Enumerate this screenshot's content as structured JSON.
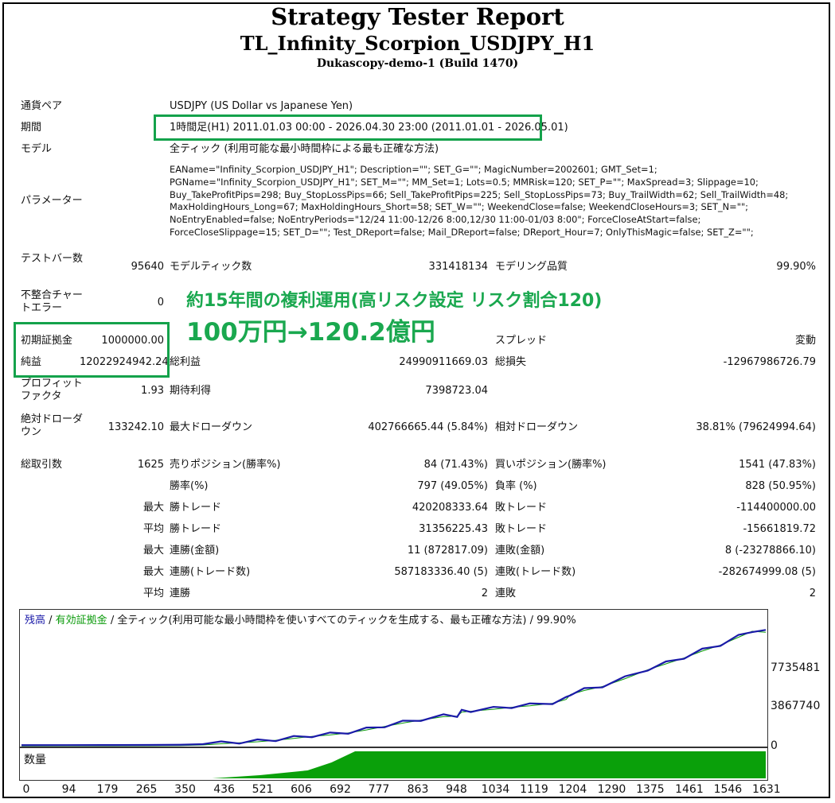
{
  "header": {
    "title": "Strategy Tester Report",
    "ea_name": "TL_Infinity_Scorpion_USDJPY_H1",
    "server": "Dukascopy-demo-1 (Build 1470)"
  },
  "info": {
    "pair_label": "通貨ペア",
    "pair_value": "USDJPY (US Dollar vs Japanese Yen)",
    "period_label": "期間",
    "period_value": "1時間足(H1) 2011.01.03 00:00 - 2026.04.30 23:00 (2011.01.01 - 2026.05.01)",
    "model_label": "モデル",
    "model_value": "全ティック (利用可能な最小時間枠による最も正確な方法)",
    "params_label": "パラメーター",
    "params_value": "EAName=\"Infinity_Scorpion_USDJPY_H1\"; Description=\"\"; SET_G=\"\"; MagicNumber=2002601; GMT_Set=1;\nPGName=\"Infinity_Scorpion_USDJPY_H1\"; SET_M=\"\"; MM_Set=1; Lots=0.5; MMRisk=120; SET_P=\"\"; MaxSpread=3; Slippage=10;\nBuy_TakeProfitPips=298; Buy_StopLossPips=66; Sell_TakeProfitPips=225; Sell_StopLossPips=73; Buy_TrailWidth=62; Sell_TrailWidth=48;\nMaxHoldingHours_Long=67; MaxHoldingHours_Short=58; SET_W=\"\"; WeekendClose=false; WeekendCloseHours=3; SET_N=\"\";\nNoEntryEnabled=false; NoEntryPeriods=\"12/24 11:00-12/26 8:00,12/30 11:00-01/03 8:00\"; ForceCloseAtStart=false;\nForceCloseSlippage=15; SET_D=\"\"; Test_DReport=false; Mail_DReport=false; DReport_Hour=7; OnlyThisMagic=false; SET_Z=\"\";"
  },
  "stats": {
    "bars_label": "テストバー数",
    "bars_value": "95640",
    "ticks_label": "モデルティック数",
    "ticks_value": "331418134",
    "quality_label": "モデリング品質",
    "quality_value": "99.90%",
    "mismatch_label": "不整合チャートエラー",
    "mismatch_value": "0",
    "deposit_label": "初期証拠金",
    "deposit_value": "1000000.00",
    "spread_label": "スプレッド",
    "spread_value": "変動",
    "net_label": "純益",
    "net_value": "12022924942.24",
    "gross_profit_label": "総利益",
    "gross_profit_value": "24990911669.03",
    "gross_loss_label": "総損失",
    "gross_loss_value": "-12967986726.79",
    "pf_label": "プロフィットファクタ",
    "pf_value": "1.93",
    "expected_label": "期待利得",
    "expected_value": "7398723.04",
    "abs_dd_label": "絶対ドローダウン",
    "abs_dd_value": "133242.10",
    "max_dd_label": "最大ドローダウン",
    "max_dd_value": "402766665.44 (5.84%)",
    "rel_dd_label": "相対ドローダウン",
    "rel_dd_value": "38.81% (79624994.64)",
    "trades_label": "総取引数",
    "trades_value": "1625",
    "short_label": "売りポジション(勝率%)",
    "short_value": "84 (71.43%)",
    "long_label": "買いポジション(勝率%)",
    "long_value": "1541 (47.83%)",
    "winrate_label": "勝率(%)",
    "winrate_value": "797 (49.05%)",
    "lossrate_label": "負率 (%)",
    "lossrate_value": "828 (50.95%)",
    "max_label": "最大",
    "avg_label": "平均",
    "largest_win_label": "勝トレード",
    "largest_win_value": "420208333.64",
    "largest_loss_label": "敗トレード",
    "largest_loss_value": "-114400000.00",
    "avg_win_label": "勝トレード",
    "avg_win_value": "31356225.43",
    "avg_loss_label": "敗トレード",
    "avg_loss_value": "-15661819.72",
    "max_consec_win_label": "連勝(金額)",
    "max_consec_win_value": "11 (872817.09)",
    "max_consec_loss_label": "連敗(金額)",
    "max_consec_loss_value": "8 (-23278866.10)",
    "max_consec_profit_label": "連勝(トレード数)",
    "max_consec_profit_value": "587183336.40 (5)",
    "max_consec_lossamt_label": "連敗(トレード数)",
    "max_consec_lossamt_value": "-282674999.08 (5)",
    "avg_consec_win_label": "連勝",
    "avg_consec_win_value": "2",
    "avg_consec_loss_label": "連敗",
    "avg_consec_loss_value": "2"
  },
  "annotation": {
    "line1": "約15年間の複利運用(高リスク設定 リスク割合120)",
    "line2": "100万円→120.2億円",
    "color": "#1aa84f"
  },
  "chart_data": {
    "type": "line",
    "legend_balance": "残高",
    "legend_sep": " / ",
    "legend_equity": "有効証拠金",
    "legend_rest": " / 全ティック(利用可能な最小時間枠を使いすべてのティックを生成する、最も正確な方法) / 99.90%",
    "balance_color": "#1a1aa8",
    "equity_color": "#0a9a0a",
    "volume_color": "#0aa00a",
    "volume_label": "数量",
    "y_ticks": [
      "7735481",
      "3867740",
      "0"
    ],
    "x_ticks": [
      "0",
      "94",
      "179",
      "265",
      "350",
      "436",
      "521",
      "606",
      "692",
      "777",
      "863",
      "948",
      "1034",
      "1119",
      "1204",
      "1290",
      "1375",
      "1461",
      "1546",
      "1631"
    ],
    "ylim": [
      0,
      12900000
    ],
    "xlim": [
      0,
      1640
    ],
    "balance": [
      [
        0,
        -20000
      ],
      [
        100,
        -15000
      ],
      [
        200,
        -10000
      ],
      [
        280,
        0
      ],
      [
        350,
        20000
      ],
      [
        400,
        80000
      ],
      [
        440,
        200000
      ],
      [
        480,
        300000
      ],
      [
        520,
        400000
      ],
      [
        560,
        550000
      ],
      [
        600,
        750000
      ],
      [
        640,
        950000
      ],
      [
        680,
        1100000
      ],
      [
        720,
        1300000
      ],
      [
        760,
        1600000
      ],
      [
        800,
        1950000
      ],
      [
        840,
        2300000
      ],
      [
        880,
        2600000
      ],
      [
        930,
        2950000
      ],
      [
        960,
        3000000
      ],
      [
        970,
        3400000
      ],
      [
        990,
        3500000
      ],
      [
        1040,
        3700000
      ],
      [
        1080,
        3900000
      ],
      [
        1120,
        4050000
      ],
      [
        1170,
        4300000
      ],
      [
        1200,
        4700000
      ],
      [
        1210,
        5200000
      ],
      [
        1240,
        5600000
      ],
      [
        1280,
        6000000
      ],
      [
        1330,
        6800000
      ],
      [
        1380,
        7700000
      ],
      [
        1420,
        8300000
      ],
      [
        1460,
        8900000
      ],
      [
        1500,
        9600000
      ],
      [
        1540,
        10200000
      ],
      [
        1580,
        11000000
      ],
      [
        1610,
        11600000
      ],
      [
        1640,
        11500000
      ]
    ],
    "volume_start": 420,
    "volume_full": 735,
    "volume_end": 1640
  }
}
